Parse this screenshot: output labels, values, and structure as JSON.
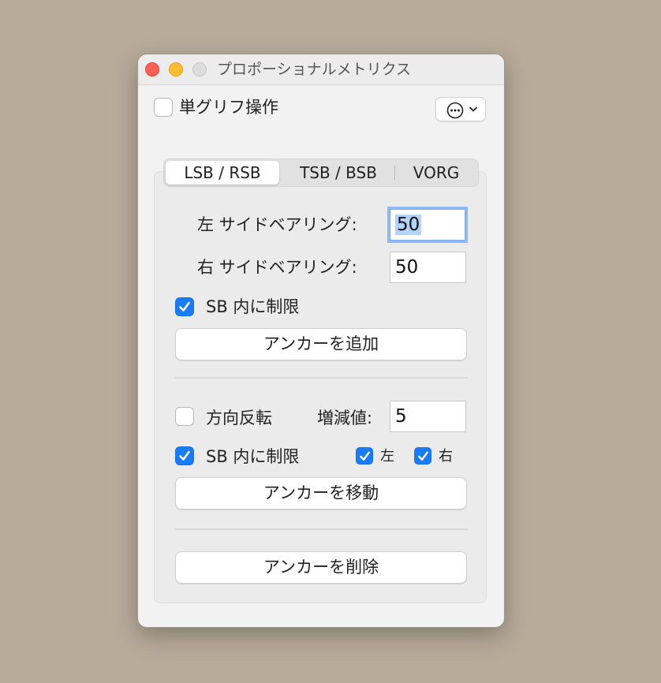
{
  "window": {
    "title": "プロポーショナルメトリクス"
  },
  "single_glyph": {
    "label": "単グリフ操作",
    "checked": false
  },
  "tabs": [
    {
      "label": "LSB / RSB",
      "selected": true
    },
    {
      "label": "TSB / BSB",
      "selected": false
    },
    {
      "label": "VORG",
      "selected": false
    }
  ],
  "lsb": {
    "label": "左 サイドベアリング:",
    "value": "50"
  },
  "rsb": {
    "label": "右 サイドベアリング:",
    "value": "50"
  },
  "limit_sb_1": {
    "label": "SB 内に制限",
    "checked": true
  },
  "add_anchor": {
    "label": "アンカーを追加"
  },
  "reverse": {
    "label": "方向反転",
    "checked": false
  },
  "increment": {
    "label": "増減値:",
    "value": "5"
  },
  "limit_sb_2": {
    "label": "SB 内に制限",
    "checked": true
  },
  "left_check": {
    "label": "左",
    "checked": true
  },
  "right_check": {
    "label": "右",
    "checked": true
  },
  "move_anchor": {
    "label": "アンカーを移動"
  },
  "delete_anchor": {
    "label": "アンカーを削除"
  },
  "colors": {
    "accent": "#1a7cf5",
    "close": "#fe5f57",
    "minimize": "#febc2e",
    "zoom_disabled": "#dcdcdc"
  }
}
